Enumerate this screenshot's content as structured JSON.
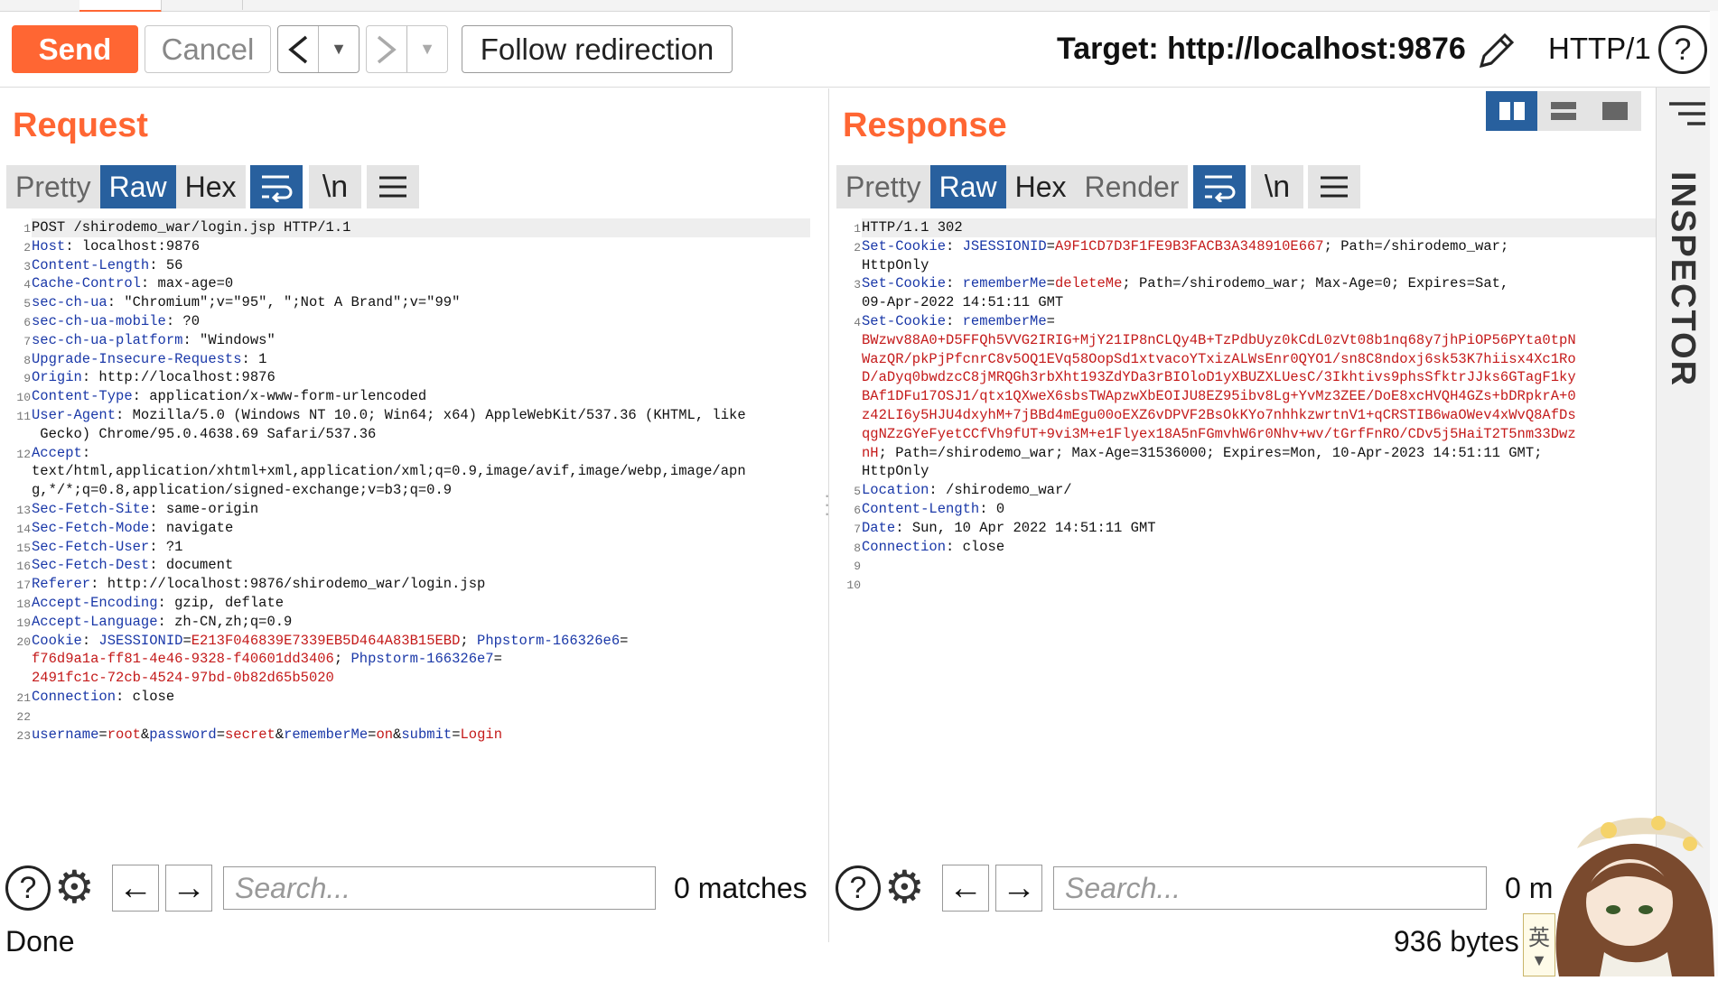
{
  "toolbar": {
    "send_label": "Send",
    "cancel_label": "Cancel",
    "follow_redirect_label": "Follow redirection",
    "target_text": "Target: http://localhost:9876",
    "protocol_label": "HTTP/1"
  },
  "request": {
    "title": "Request",
    "modes": [
      "Pretty",
      "Raw",
      "Hex"
    ],
    "selected_mode": "Raw",
    "lines": [
      {
        "n": "1",
        "segs": [
          [
            "t",
            "POST /shirodemo_war/login.jsp HTTP/1.1"
          ]
        ]
      },
      {
        "n": "2",
        "segs": [
          [
            "k",
            "Host"
          ],
          [
            "t",
            ": localhost:9876"
          ]
        ]
      },
      {
        "n": "3",
        "segs": [
          [
            "k",
            "Content-Length"
          ],
          [
            "t",
            ": 56"
          ]
        ]
      },
      {
        "n": "4",
        "segs": [
          [
            "k",
            "Cache-Control"
          ],
          [
            "t",
            ": max-age=0"
          ]
        ]
      },
      {
        "n": "5",
        "segs": [
          [
            "k",
            "sec-ch-ua"
          ],
          [
            "t",
            ": \"Chromium\";v=\"95\", \";Not A Brand\";v=\"99\""
          ]
        ]
      },
      {
        "n": "6",
        "segs": [
          [
            "k",
            "sec-ch-ua-mobile"
          ],
          [
            "t",
            ": ?0"
          ]
        ]
      },
      {
        "n": "7",
        "segs": [
          [
            "k",
            "sec-ch-ua-platform"
          ],
          [
            "t",
            ": \"Windows\""
          ]
        ]
      },
      {
        "n": "8",
        "segs": [
          [
            "k",
            "Upgrade-Insecure-Requests"
          ],
          [
            "t",
            ": 1"
          ]
        ]
      },
      {
        "n": "9",
        "segs": [
          [
            "k",
            "Origin"
          ],
          [
            "t",
            ": http://localhost:9876"
          ]
        ]
      },
      {
        "n": "10",
        "segs": [
          [
            "k",
            "Content-Type"
          ],
          [
            "t",
            ": application/x-www-form-urlencoded"
          ]
        ]
      },
      {
        "n": "11",
        "segs": [
          [
            "k",
            "User-Agent"
          ],
          [
            "t",
            ": Mozilla/5.0 (Windows NT 10.0; Win64; x64) AppleWebKit/537.36 (KHTML, like"
          ]
        ]
      },
      {
        "n": "",
        "segs": [
          [
            "t",
            " Gecko) Chrome/95.0.4638.69 Safari/537.36"
          ]
        ]
      },
      {
        "n": "12",
        "segs": [
          [
            "k",
            "Accept"
          ],
          [
            "t",
            ":"
          ]
        ]
      },
      {
        "n": "",
        "segs": [
          [
            "t",
            "text/html,application/xhtml+xml,application/xml;q=0.9,image/avif,image/webp,image/apn"
          ]
        ]
      },
      {
        "n": "",
        "segs": [
          [
            "t",
            "g,*/*;q=0.8,application/signed-exchange;v=b3;q=0.9"
          ]
        ]
      },
      {
        "n": "13",
        "segs": [
          [
            "k",
            "Sec-Fetch-Site"
          ],
          [
            "t",
            ": same-origin"
          ]
        ]
      },
      {
        "n": "14",
        "segs": [
          [
            "k",
            "Sec-Fetch-Mode"
          ],
          [
            "t",
            ": navigate"
          ]
        ]
      },
      {
        "n": "15",
        "segs": [
          [
            "k",
            "Sec-Fetch-User"
          ],
          [
            "t",
            ": ?1"
          ]
        ]
      },
      {
        "n": "16",
        "segs": [
          [
            "k",
            "Sec-Fetch-Dest"
          ],
          [
            "t",
            ": document"
          ]
        ]
      },
      {
        "n": "17",
        "segs": [
          [
            "k",
            "Referer"
          ],
          [
            "t",
            ": http://localhost:9876/shirodemo_war/login.jsp"
          ]
        ]
      },
      {
        "n": "18",
        "segs": [
          [
            "k",
            "Accept-Encoding"
          ],
          [
            "t",
            ": gzip, deflate"
          ]
        ]
      },
      {
        "n": "19",
        "segs": [
          [
            "k",
            "Accept-Language"
          ],
          [
            "t",
            ": zh-CN,zh;q=0.9"
          ]
        ]
      },
      {
        "n": "20",
        "segs": [
          [
            "k",
            "Cookie"
          ],
          [
            "t",
            ": "
          ],
          [
            "k",
            "JSESSIONID"
          ],
          [
            "t",
            "="
          ],
          [
            "v",
            "E213F046839E7339EB5D464A83B15EBD"
          ],
          [
            "t",
            "; "
          ],
          [
            "k",
            "Phpstorm-166326e6"
          ],
          [
            "t",
            "="
          ]
        ]
      },
      {
        "n": "",
        "segs": [
          [
            "v",
            "f76d9a1a-ff81-4e46-9328-f40601dd3406"
          ],
          [
            "t",
            "; "
          ],
          [
            "k",
            "Phpstorm-166326e7"
          ],
          [
            "t",
            "="
          ]
        ]
      },
      {
        "n": "",
        "segs": [
          [
            "v",
            "2491fc1c-72cb-4524-97bd-0b82d65b5020"
          ]
        ]
      },
      {
        "n": "21",
        "segs": [
          [
            "k",
            "Connection"
          ],
          [
            "t",
            ": close"
          ]
        ]
      },
      {
        "n": "22",
        "segs": []
      },
      {
        "n": "23",
        "segs": [
          [
            "k",
            "username"
          ],
          [
            "t",
            "="
          ],
          [
            "v",
            "root"
          ],
          [
            "t",
            "&"
          ],
          [
            "k",
            "password"
          ],
          [
            "t",
            "="
          ],
          [
            "v",
            "secret"
          ],
          [
            "t",
            "&"
          ],
          [
            "k",
            "rememberMe"
          ],
          [
            "t",
            "="
          ],
          [
            "v",
            "on"
          ],
          [
            "t",
            "&"
          ],
          [
            "k",
            "submit"
          ],
          [
            "t",
            "="
          ],
          [
            "v",
            "Login"
          ]
        ]
      }
    ],
    "search_placeholder": "Search...",
    "matches_text": "0 matches"
  },
  "response": {
    "title": "Response",
    "modes": [
      "Pretty",
      "Raw",
      "Hex",
      "Render"
    ],
    "selected_mode": "Raw",
    "lines": [
      {
        "n": "1",
        "segs": [
          [
            "t",
            "HTTP/1.1 302"
          ]
        ]
      },
      {
        "n": "2",
        "segs": [
          [
            "k",
            "Set-Cookie"
          ],
          [
            "t",
            ": "
          ],
          [
            "k",
            "JSESSIONID"
          ],
          [
            "t",
            "="
          ],
          [
            "v",
            "A9F1CD7D3F1FE9B3FACB3A348910E667"
          ],
          [
            "t",
            "; Path=/shirodemo_war;"
          ]
        ]
      },
      {
        "n": "",
        "segs": [
          [
            "t",
            "HttpOnly"
          ]
        ]
      },
      {
        "n": "3",
        "segs": [
          [
            "k",
            "Set-Cookie"
          ],
          [
            "t",
            ": "
          ],
          [
            "k",
            "rememberMe"
          ],
          [
            "t",
            "="
          ],
          [
            "v",
            "deleteMe"
          ],
          [
            "t",
            "; Path=/shirodemo_war; Max-Age=0; Expires=Sat,"
          ]
        ]
      },
      {
        "n": "",
        "segs": [
          [
            "t",
            "09-Apr-2022 14:51:11 GMT"
          ]
        ]
      },
      {
        "n": "4",
        "segs": [
          [
            "k",
            "Set-Cookie"
          ],
          [
            "t",
            ": "
          ],
          [
            "k",
            "rememberMe"
          ],
          [
            "t",
            "="
          ]
        ]
      },
      {
        "n": "",
        "segs": [
          [
            "v",
            "BWzwv88A0+D5FFQh5VVG2IRIG+MjY21IP8nCLQy4B+TzPdbUyz0kCdL0zVt08b1nq68y7jhPiOP56PYta0tpN"
          ]
        ]
      },
      {
        "n": "",
        "segs": [
          [
            "v",
            "WazQR/pkPjPfcnrC8v5OQ1EVq58OopSd1xtvacoYTxizALWsEnr0QYO1/sn8C8ndoxj6sk53K7hiisx4Xc1Ro"
          ]
        ]
      },
      {
        "n": "",
        "segs": [
          [
            "v",
            "D/aDyq0bwdzcC8jMRQGh3rbXht193ZdYDa3rBIOloD1yXBUZXLUesC/3Ikhtivs9phsSfktrJJks6GTagF1ky"
          ]
        ]
      },
      {
        "n": "",
        "segs": [
          [
            "v",
            "BAf1DFu17OSJ1/qtx1QXweX6sbsTWApzwXbEOIJU8EZ95ibv8Lg+YvMz3ZEE/DoE8xcHVQH4GZs+bDRpkrA+0"
          ]
        ]
      },
      {
        "n": "",
        "segs": [
          [
            "v",
            "z42LI6y5HJU4dxyhM+7jBBd4mEgu00oEXZ6vDPVF2BsOkKYo7nhhkzwrtnV1+qCRSTIB6waOWev4xWvQ8AfDs"
          ]
        ]
      },
      {
        "n": "",
        "segs": [
          [
            "v",
            "qgNZzGYeFyetCCfVh9fUT+9vi3M+e1Flyex18A5nFGmvhW6r0Nhv+wv/tGrfFnRO/CDv5j5HaiT2T5nm33Dwz"
          ]
        ]
      },
      {
        "n": "",
        "segs": [
          [
            "v",
            "nH"
          ],
          [
            "t",
            "; Path=/shirodemo_war; Max-Age=31536000; Expires=Mon, 10-Apr-2023 14:51:11 GMT;"
          ]
        ]
      },
      {
        "n": "",
        "segs": [
          [
            "t",
            "HttpOnly"
          ]
        ]
      },
      {
        "n": "5",
        "segs": [
          [
            "k",
            "Location"
          ],
          [
            "t",
            ": /shirodemo_war/"
          ]
        ]
      },
      {
        "n": "6",
        "segs": [
          [
            "k",
            "Content-Length"
          ],
          [
            "t",
            ": 0"
          ]
        ]
      },
      {
        "n": "7",
        "segs": [
          [
            "k",
            "Date"
          ],
          [
            "t",
            ": Sun, 10 Apr 2022 14:51:11 GMT"
          ]
        ]
      },
      {
        "n": "8",
        "segs": [
          [
            "k",
            "Connection"
          ],
          [
            "t",
            ": close"
          ]
        ]
      },
      {
        "n": "9",
        "segs": []
      },
      {
        "n": "10",
        "segs": []
      }
    ],
    "search_placeholder": "Search...",
    "matches_text": "0 m"
  },
  "sidebar": {
    "title": "INSPECTOR"
  },
  "status": {
    "left": "Done",
    "right": "936 bytes"
  },
  "ime_label": "英",
  "icons": {
    "wrap": "wrap-lines-icon",
    "newline": "show-newlines-icon",
    "menu": "menu-icon",
    "help": "help-icon",
    "settings": "gear-icon",
    "prev": "arrow-left-icon",
    "next": "arrow-right-icon",
    "edit": "pencil-icon"
  },
  "colors": {
    "accent": "#ff6633",
    "selected": "#28609e",
    "key": "#1a38a8",
    "value": "#c41a1a"
  }
}
